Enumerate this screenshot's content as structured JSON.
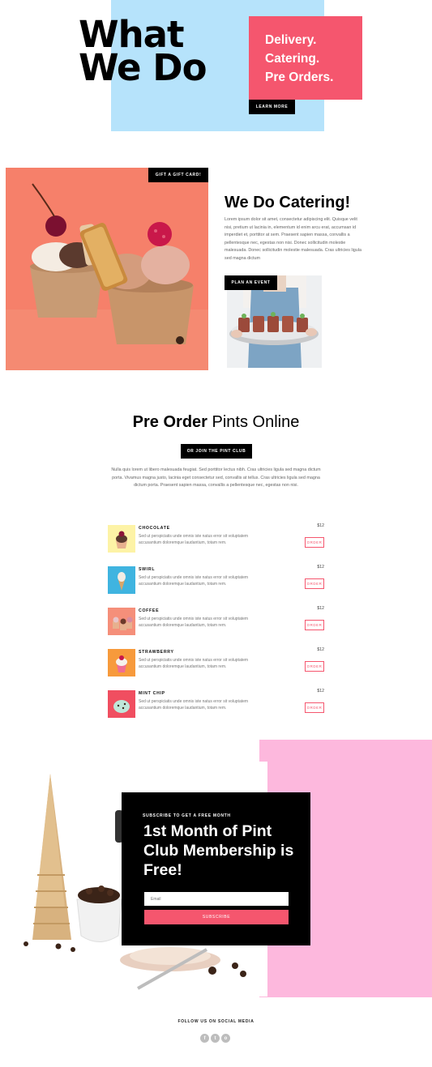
{
  "hero": {
    "title_line1": "What",
    "title_line2": "We Do",
    "services": [
      "Delivery.",
      "Catering.",
      "Pre Orders."
    ],
    "learn_more": "LEARN MORE"
  },
  "catering": {
    "gift_card": "GIFT A GIFT CARD!",
    "title_prefix": "We Do ",
    "title_bold": "Catering!",
    "body": "Lorem ipsum dolor sit amet, consectetur adipiscing elit. Quisque velit nisi, pretium ut lacinia in, elementum id enim arcu erat, accumsan id imperdiet et, porttitor at sem. Praesent sapien massa, convallis a pellentesque nec, egestas non nisi. Donec sollicitudin molestie malesuada. Donec sollicitudin molestie malesuada. Cras ultricies ligula sed magna dictum",
    "plan_event": "PLAN AN EVENT"
  },
  "pints": {
    "title_bold": "Pre Order",
    "title_light": " Pints Online",
    "club_button": "OR JOIN THE PINT CLUB",
    "body": "Nulla quis lorem ut libero malesuada feugiat. Sed porttitor lectus nibh. Cras ultricies ligula sed magna dictum porta. Vivamus magna justo, lacinia eget consectetur sed, convallis at tellus. Cras ultricies ligula sed magna dictum porta. Praesent sapien massa, convallis a pellentesque nec, egestas non nisi.",
    "items": [
      {
        "name": "CHOCOLATE",
        "price": "$12",
        "desc": "Sed ut perspiciatis unde omnis iste natus error sit voluptatem accusantium doloremque laudantium, totam rem.",
        "order": "ORDER",
        "bg": "#fdf3a6"
      },
      {
        "name": "SWIRL",
        "price": "$12",
        "desc": "Sed ut perspiciatis unde omnis iste natus error sit voluptatem accusantium doloremque laudantium, totam rem.",
        "order": "ORDER",
        "bg": "#3fb4e0"
      },
      {
        "name": "COFFEE",
        "price": "$12",
        "desc": "Sed ut perspiciatis unde omnis iste natus error sit voluptatem accusantium doloremque laudantium, totam rem.",
        "order": "ORDER",
        "bg": "#f58f7a"
      },
      {
        "name": "STRAWBERRY",
        "price": "$12",
        "desc": "Sed ut perspiciatis unde omnis iste natus error sit voluptatem accusantium doloremque laudantium, totam rem.",
        "order": "ORDER",
        "bg": "#f79a3c"
      },
      {
        "name": "MINT CHIP",
        "price": "$12",
        "desc": "Sed ut perspiciatis unde omnis iste natus error sit voluptatem accusantium doloremque laudantium, totam rem.",
        "order": "ORDER",
        "bg": "#f04e60"
      }
    ]
  },
  "membership": {
    "kicker": "SUBSCRIBE TO GET A FREE MONTH",
    "head_light": "1st Month of Pint Club ",
    "head_bold": "Membership is Free!",
    "email_placeholder": "Email",
    "subscribe": "SUBSCRIBE"
  },
  "footer": {
    "follow": "FOLLOW US ON SOCIAL MEDIA",
    "socials": [
      "f",
      "t",
      "o"
    ]
  },
  "colors": {
    "accent_pink": "#f5566e",
    "hero_blue": "#b6e3fb",
    "light_pink": "#fdb8dd",
    "coral": "#f6806a"
  }
}
